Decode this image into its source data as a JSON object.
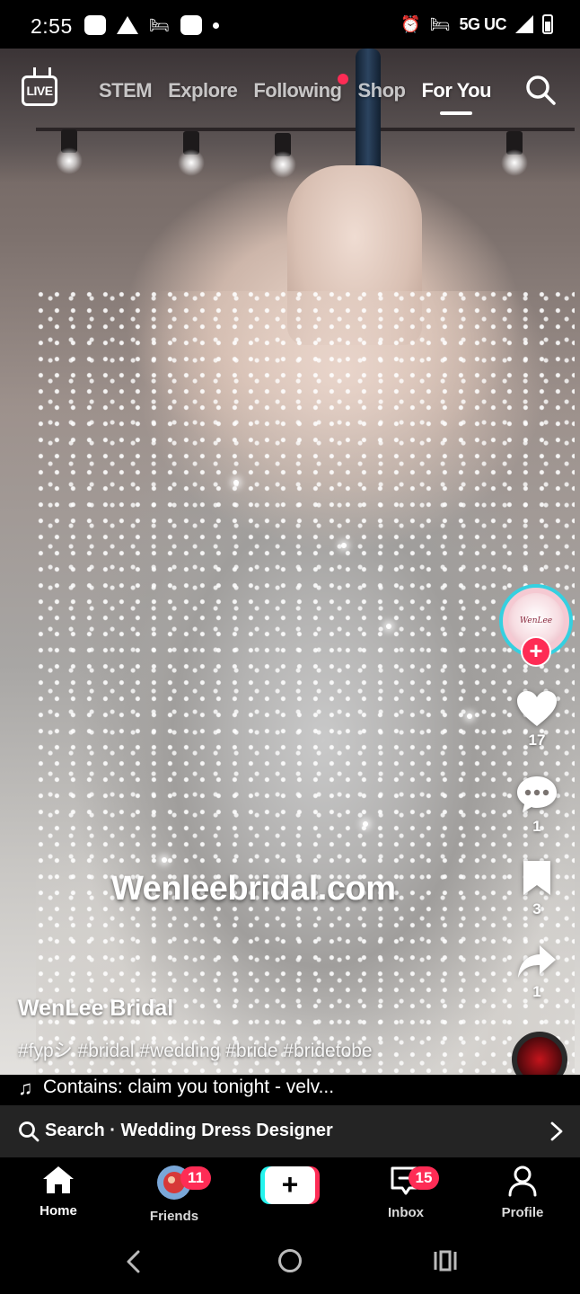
{
  "status_bar": {
    "time": "2:55",
    "network": "5G UC"
  },
  "top_nav": {
    "live_label": "LIVE",
    "tabs": [
      {
        "label": "STEM",
        "active": false
      },
      {
        "label": "Explore",
        "active": false
      },
      {
        "label": "Following",
        "active": false,
        "has_notification_dot": true
      },
      {
        "label": "Shop",
        "active": false
      },
      {
        "label": "For You",
        "active": true
      }
    ]
  },
  "video": {
    "watermark": "Wenleebridal.com",
    "author": "WenLee Bridal",
    "hashtags": "#fypシ #bridal #wedding #bride #bridetobe",
    "music": "Contains: claim you tonight - velv...",
    "avatar_text": "WenLee Bridal"
  },
  "actions": {
    "likes": "17",
    "comments": "1",
    "saves": "3",
    "shares": "1"
  },
  "search_bar": {
    "label": "Search · Wedding Dress Designer"
  },
  "bottom_nav": {
    "items": [
      {
        "label": "Home",
        "active": true
      },
      {
        "label": "Friends",
        "badge": "11"
      },
      {
        "label": "Inbox",
        "badge": "15"
      },
      {
        "label": "Profile"
      }
    ]
  },
  "colors": {
    "accent_red": "#fe2c55",
    "accent_cyan": "#25f4ee",
    "search_bg": "#242424"
  }
}
